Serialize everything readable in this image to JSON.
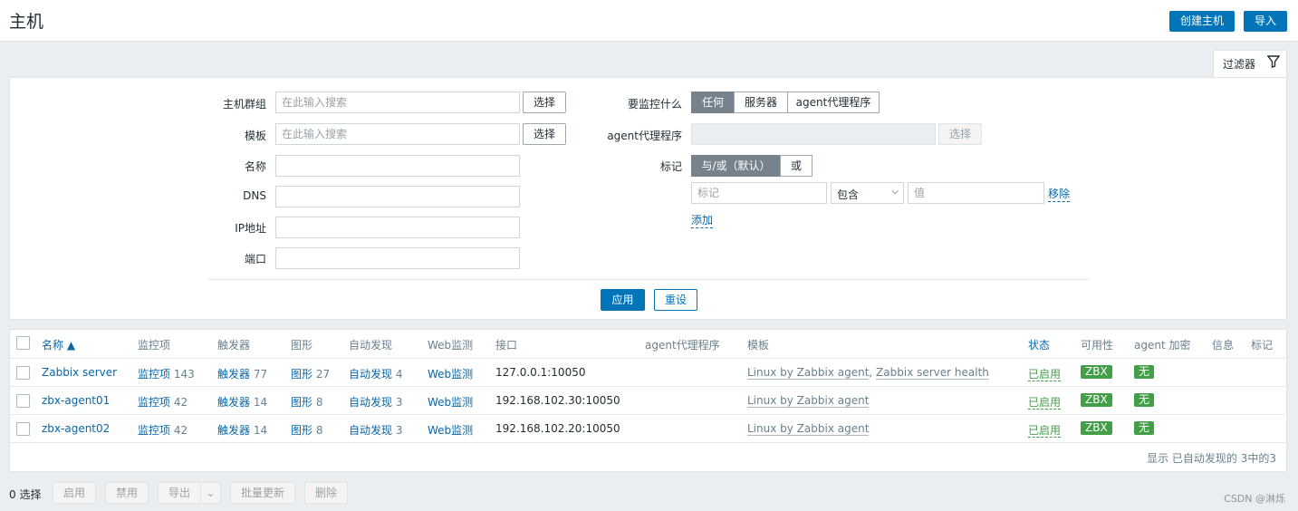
{
  "header": {
    "title": "主机",
    "create_button": "创建主机",
    "import_button": "导入"
  },
  "filter_tab": {
    "label": "过滤器",
    "icon": "filter-icon"
  },
  "filter": {
    "host_group": {
      "label": "主机群组",
      "placeholder": "在此输入搜索",
      "select": "选择"
    },
    "template": {
      "label": "模板",
      "placeholder": "在此输入搜索",
      "select": "选择"
    },
    "name": {
      "label": "名称"
    },
    "dns": {
      "label": "DNS"
    },
    "ip": {
      "label": "IP地址"
    },
    "port": {
      "label": "端口"
    },
    "monitored_by": {
      "label": "要监控什么",
      "options": [
        "任何",
        "服务器",
        "agent代理程序"
      ],
      "selected": "任何"
    },
    "proxy": {
      "label": "agent代理程序",
      "select": "选择"
    },
    "tags": {
      "label": "标记",
      "options": [
        "与/或（默认）",
        "或"
      ],
      "selected": "与/或（默认）",
      "tag_placeholder": "标记",
      "operator": "包含",
      "value_placeholder": "值",
      "remove": "移除",
      "add": "添加"
    },
    "apply": "应用",
    "reset": "重设"
  },
  "table": {
    "columns": [
      "名称 ▲",
      "监控项",
      "触发器",
      "图形",
      "自动发现",
      "Web监测",
      "接口",
      "agent代理程序",
      "模板",
      "状态",
      "可用性",
      "agent 加密",
      "信息",
      "标记"
    ],
    "rows": [
      {
        "name": "Zabbix server",
        "items": "监控项",
        "items_count": "143",
        "triggers": "触发器",
        "triggers_count": "77",
        "graphs": "图形",
        "graphs_count": "27",
        "discovery": "自动发现",
        "discovery_count": "4",
        "web": "Web监测",
        "interface": "127.0.0.1:10050",
        "template1": "Linux by Zabbix agent",
        "template_sep": ", ",
        "template2": "Zabbix server health",
        "status": "已启用",
        "availability": "ZBX",
        "encryption": "无"
      },
      {
        "name": "zbx-agent01",
        "items": "监控项",
        "items_count": "42",
        "triggers": "触发器",
        "triggers_count": "14",
        "graphs": "图形",
        "graphs_count": "8",
        "discovery": "自动发现",
        "discovery_count": "3",
        "web": "Web监测",
        "interface": "192.168.102.30:10050",
        "template1": "Linux by Zabbix agent",
        "status": "已启用",
        "availability": "ZBX",
        "encryption": "无"
      },
      {
        "name": "zbx-agent02",
        "items": "监控项",
        "items_count": "42",
        "triggers": "触发器",
        "triggers_count": "14",
        "graphs": "图形",
        "graphs_count": "8",
        "discovery": "自动发现",
        "discovery_count": "3",
        "web": "Web监测",
        "interface": "192.168.102.20:10050",
        "template1": "Linux by Zabbix agent",
        "status": "已启用",
        "availability": "ZBX",
        "encryption": "无"
      }
    ],
    "footer": "显示 已自动发现的 3中的3"
  },
  "actions": {
    "selected": "0 选择",
    "enable": "启用",
    "disable": "禁用",
    "export": "导出",
    "mass_update": "批量更新",
    "delete": "删除"
  },
  "watermark": "CSDN @淋烁"
}
